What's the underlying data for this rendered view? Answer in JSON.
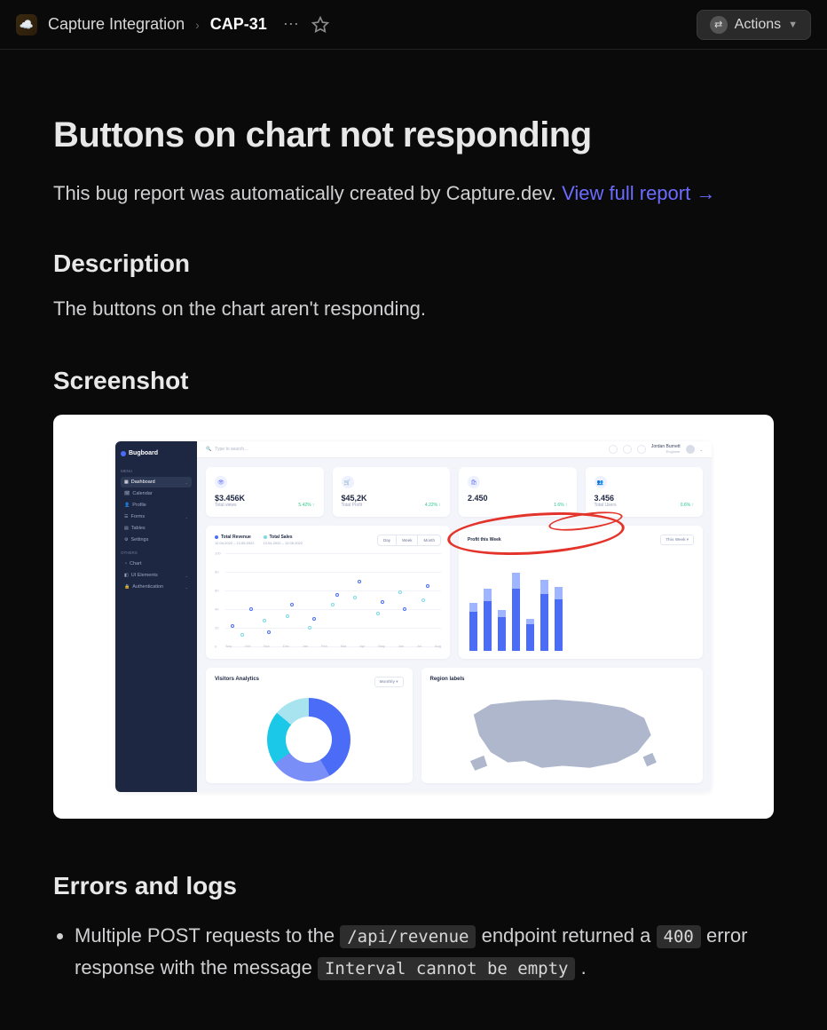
{
  "header": {
    "project": "Capture Integration",
    "issue_key": "CAP-31",
    "actions_label": "Actions"
  },
  "page": {
    "title": "Buttons on chart not responding",
    "intro_prefix": "This bug report was automatically created by Capture.dev. ",
    "link_text": "View full report →"
  },
  "description": {
    "heading": "Description",
    "body": "The buttons on the chart aren't responding."
  },
  "screenshot": {
    "heading": "Screenshot",
    "dash": {
      "brand": "Bugboard",
      "menu_heading": "MENU",
      "others_heading": "OTHERS",
      "nav_menu": [
        "Dashboard",
        "Calendar",
        "Profile",
        "Forms",
        "Tables",
        "Settings"
      ],
      "nav_others": [
        "Chart",
        "UI Elements",
        "Authentication"
      ],
      "search_placeholder": "Type to search…",
      "user_name": "Jordan Burnett",
      "user_role": "Engineer",
      "kpis": [
        {
          "icon": "👁",
          "value": "$3.456K",
          "label": "Total views",
          "delta": "5.42% ↑"
        },
        {
          "icon": "🛒",
          "value": "$45,2K",
          "label": "Total Profit",
          "delta": "4.22% ↑"
        },
        {
          "icon": "🛍",
          "value": "2.450",
          "label": "",
          "delta": "1.6% ↑"
        },
        {
          "icon": "👥",
          "value": "3.456",
          "label": "Total Users",
          "delta": "0.6% ↑"
        }
      ],
      "chart": {
        "legend": [
          {
            "name": "Total Revenue",
            "range": "12.04.2022 – 12.05.2022",
            "color": "#4a6cf7"
          },
          {
            "name": "Total Sales",
            "range": "12.04.2022 – 12.05.2022",
            "color": "#7bd9e8"
          }
        ],
        "segments": [
          "Day",
          "Week",
          "Month"
        ],
        "y_ticks": [
          "0",
          "20",
          "40",
          "60",
          "80",
          "100"
        ],
        "x_ticks": [
          "Sep",
          "Oct",
          "Nov",
          "Dec",
          "Jan",
          "Feb",
          "Mar",
          "Apr",
          "May",
          "Jun",
          "Jul",
          "Aug"
        ]
      },
      "bars": {
        "title": "Profit this Week",
        "dropdown": "This Week ▾"
      },
      "donut": {
        "title": "Visitors Analytics",
        "dropdown": "Monthly ▾"
      },
      "map": {
        "title": "Region labels"
      }
    }
  },
  "errors": {
    "heading": "Errors and logs",
    "line_parts": {
      "p1": "Multiple POST requests to the ",
      "code1": "/api/revenue",
      "p2": " endpoint returned a ",
      "code2": "400",
      "p3": " error response with the message ",
      "code3": "Interval cannot be empty",
      "p4": " ."
    }
  }
}
